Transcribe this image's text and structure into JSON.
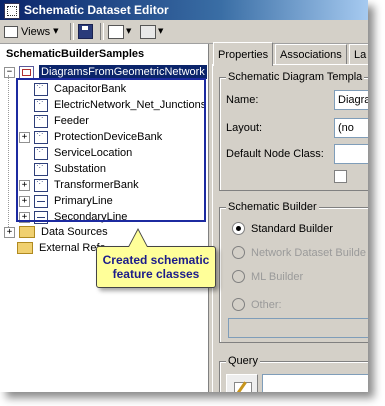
{
  "window": {
    "title": "Schematic Dataset Editor"
  },
  "toolbar": {
    "views_label": "Views"
  },
  "tree": {
    "root_label": "SchematicBuilderSamples",
    "diagram_label": "DiagramsFromGeometricNetwork",
    "items": [
      {
        "label": "CapacitorBank",
        "expandable": false,
        "icon": "point-feature-class-icon"
      },
      {
        "label": "ElectricNetwork_Net_Junctions",
        "expandable": false,
        "icon": "point-feature-class-icon"
      },
      {
        "label": "Feeder",
        "expandable": false,
        "icon": "point-feature-class-icon"
      },
      {
        "label": "ProtectionDeviceBank",
        "expandable": true,
        "icon": "point-feature-class-icon"
      },
      {
        "label": "ServiceLocation",
        "expandable": false,
        "icon": "point-feature-class-icon"
      },
      {
        "label": "Substation",
        "expandable": false,
        "icon": "point-feature-class-icon"
      },
      {
        "label": "TransformerBank",
        "expandable": true,
        "icon": "point-feature-class-icon"
      },
      {
        "label": "PrimaryLine",
        "expandable": true,
        "icon": "line-feature-class-icon"
      },
      {
        "label": "SecondaryLine",
        "expandable": true,
        "icon": "line-feature-class-icon"
      }
    ],
    "folders": [
      {
        "label": "Data Sources"
      },
      {
        "label": "External Refe"
      }
    ]
  },
  "tabs": [
    {
      "label": "Properties",
      "active": true
    },
    {
      "label": "Associations",
      "active": false
    },
    {
      "label": "La",
      "active": false
    }
  ],
  "properties": {
    "template_group": "Schematic Diagram Templa",
    "name_label": "Name:",
    "name_value": "Diagra",
    "layout_label": "Layout:",
    "layout_value": "(no",
    "node_class_label": "Default Node Class:",
    "builder_group": "Schematic Builder",
    "builder_options": [
      {
        "label": "Standard Builder",
        "selected": true,
        "enabled": true
      },
      {
        "label": "Network Dataset Builde",
        "selected": false,
        "enabled": false
      },
      {
        "label": "ML Builder",
        "selected": false,
        "enabled": false
      },
      {
        "label": "Other:",
        "selected": false,
        "enabled": false
      }
    ],
    "query_group": "Query"
  },
  "callout": {
    "line1": "Created schematic",
    "line2": "feature classes"
  }
}
